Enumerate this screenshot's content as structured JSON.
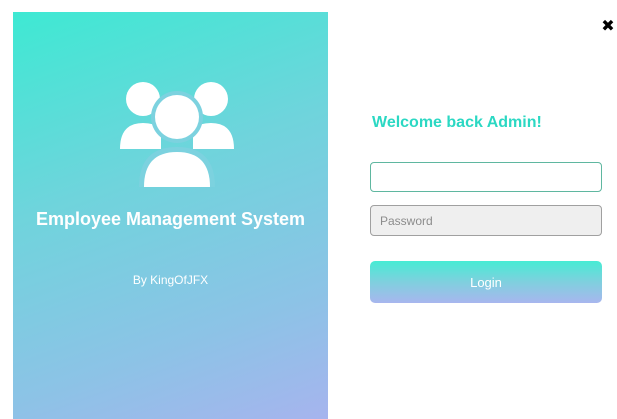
{
  "brand": {
    "app_title": "Employee Management System",
    "author": "By KingOfJFX",
    "logo_icon": "users-group-icon"
  },
  "window": {
    "close_glyph": "✖",
    "close_icon": "close-icon"
  },
  "login": {
    "welcome": "Welcome back Admin!",
    "username_value": "",
    "username_placeholder": "",
    "password_placeholder": "Password",
    "button_label": "Login"
  },
  "colors": {
    "accent": "#2bd8c3",
    "gradient_start": "#3ee9d3",
    "gradient_end": "#a6b4ee",
    "username_border": "#5fb7a0"
  }
}
